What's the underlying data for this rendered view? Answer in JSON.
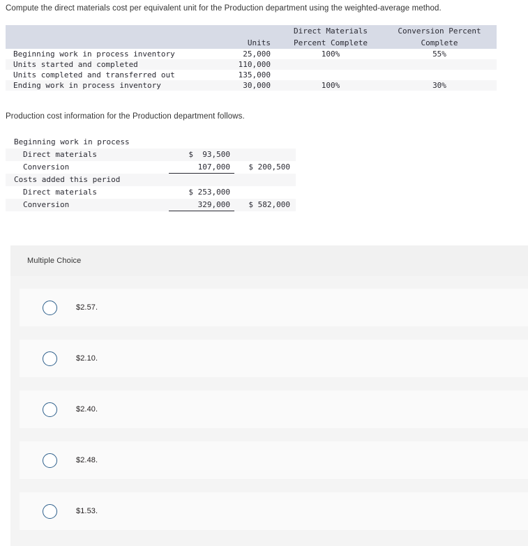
{
  "question": {
    "prompt": "Compute the direct materials cost per equivalent unit for the Production department using the weighted-average method.",
    "sub_prompt": "Production cost information for the Production department follows."
  },
  "units_table": {
    "headers": {
      "blank": "",
      "units": "Units",
      "direct_materials_line1": "Direct Materials",
      "direct_materials_line2": "Percent Complete",
      "conversion_line1": "Conversion Percent",
      "conversion_line2": "Complete"
    },
    "rows": [
      {
        "label": "Beginning work in process inventory",
        "units": "25,000",
        "dm_pct": "100%",
        "conv_pct": "55%"
      },
      {
        "label": "Units started and completed",
        "units": "110,000",
        "dm_pct": "",
        "conv_pct": ""
      },
      {
        "label": "Units completed and transferred out",
        "units": "135,000",
        "dm_pct": "",
        "conv_pct": ""
      },
      {
        "label": "Ending work in process inventory",
        "units": "30,000",
        "dm_pct": "100%",
        "conv_pct": "30%"
      }
    ]
  },
  "cost_table": {
    "rows": [
      {
        "name": "Beginning work in process",
        "amount": "",
        "total": ""
      },
      {
        "name": "Direct materials",
        "amount": "$  93,500",
        "total": ""
      },
      {
        "name": "Conversion",
        "amount": "107,000",
        "total": "$ 200,500"
      },
      {
        "name": "Costs added this period",
        "amount": "",
        "total": ""
      },
      {
        "name": "Direct materials",
        "amount": "$ 253,000",
        "total": ""
      },
      {
        "name": "Conversion",
        "amount": "329,000",
        "total": "$ 582,000"
      }
    ]
  },
  "multiple_choice": {
    "title": "Multiple Choice",
    "options": [
      {
        "label": "$2.57."
      },
      {
        "label": "$2.10."
      },
      {
        "label": "$2.40."
      },
      {
        "label": "$2.48."
      },
      {
        "label": "$1.53."
      }
    ]
  },
  "colors": {
    "table_header_bg": "#d7dbe6",
    "row_shade_bg": "#f6f6f7",
    "panel_bg": "#f4f4f4",
    "panel_header_bg": "#f1f1f1",
    "option_card_bg": "#fafafa",
    "radio_border": "#2d5f8b",
    "text": "#231f20"
  }
}
